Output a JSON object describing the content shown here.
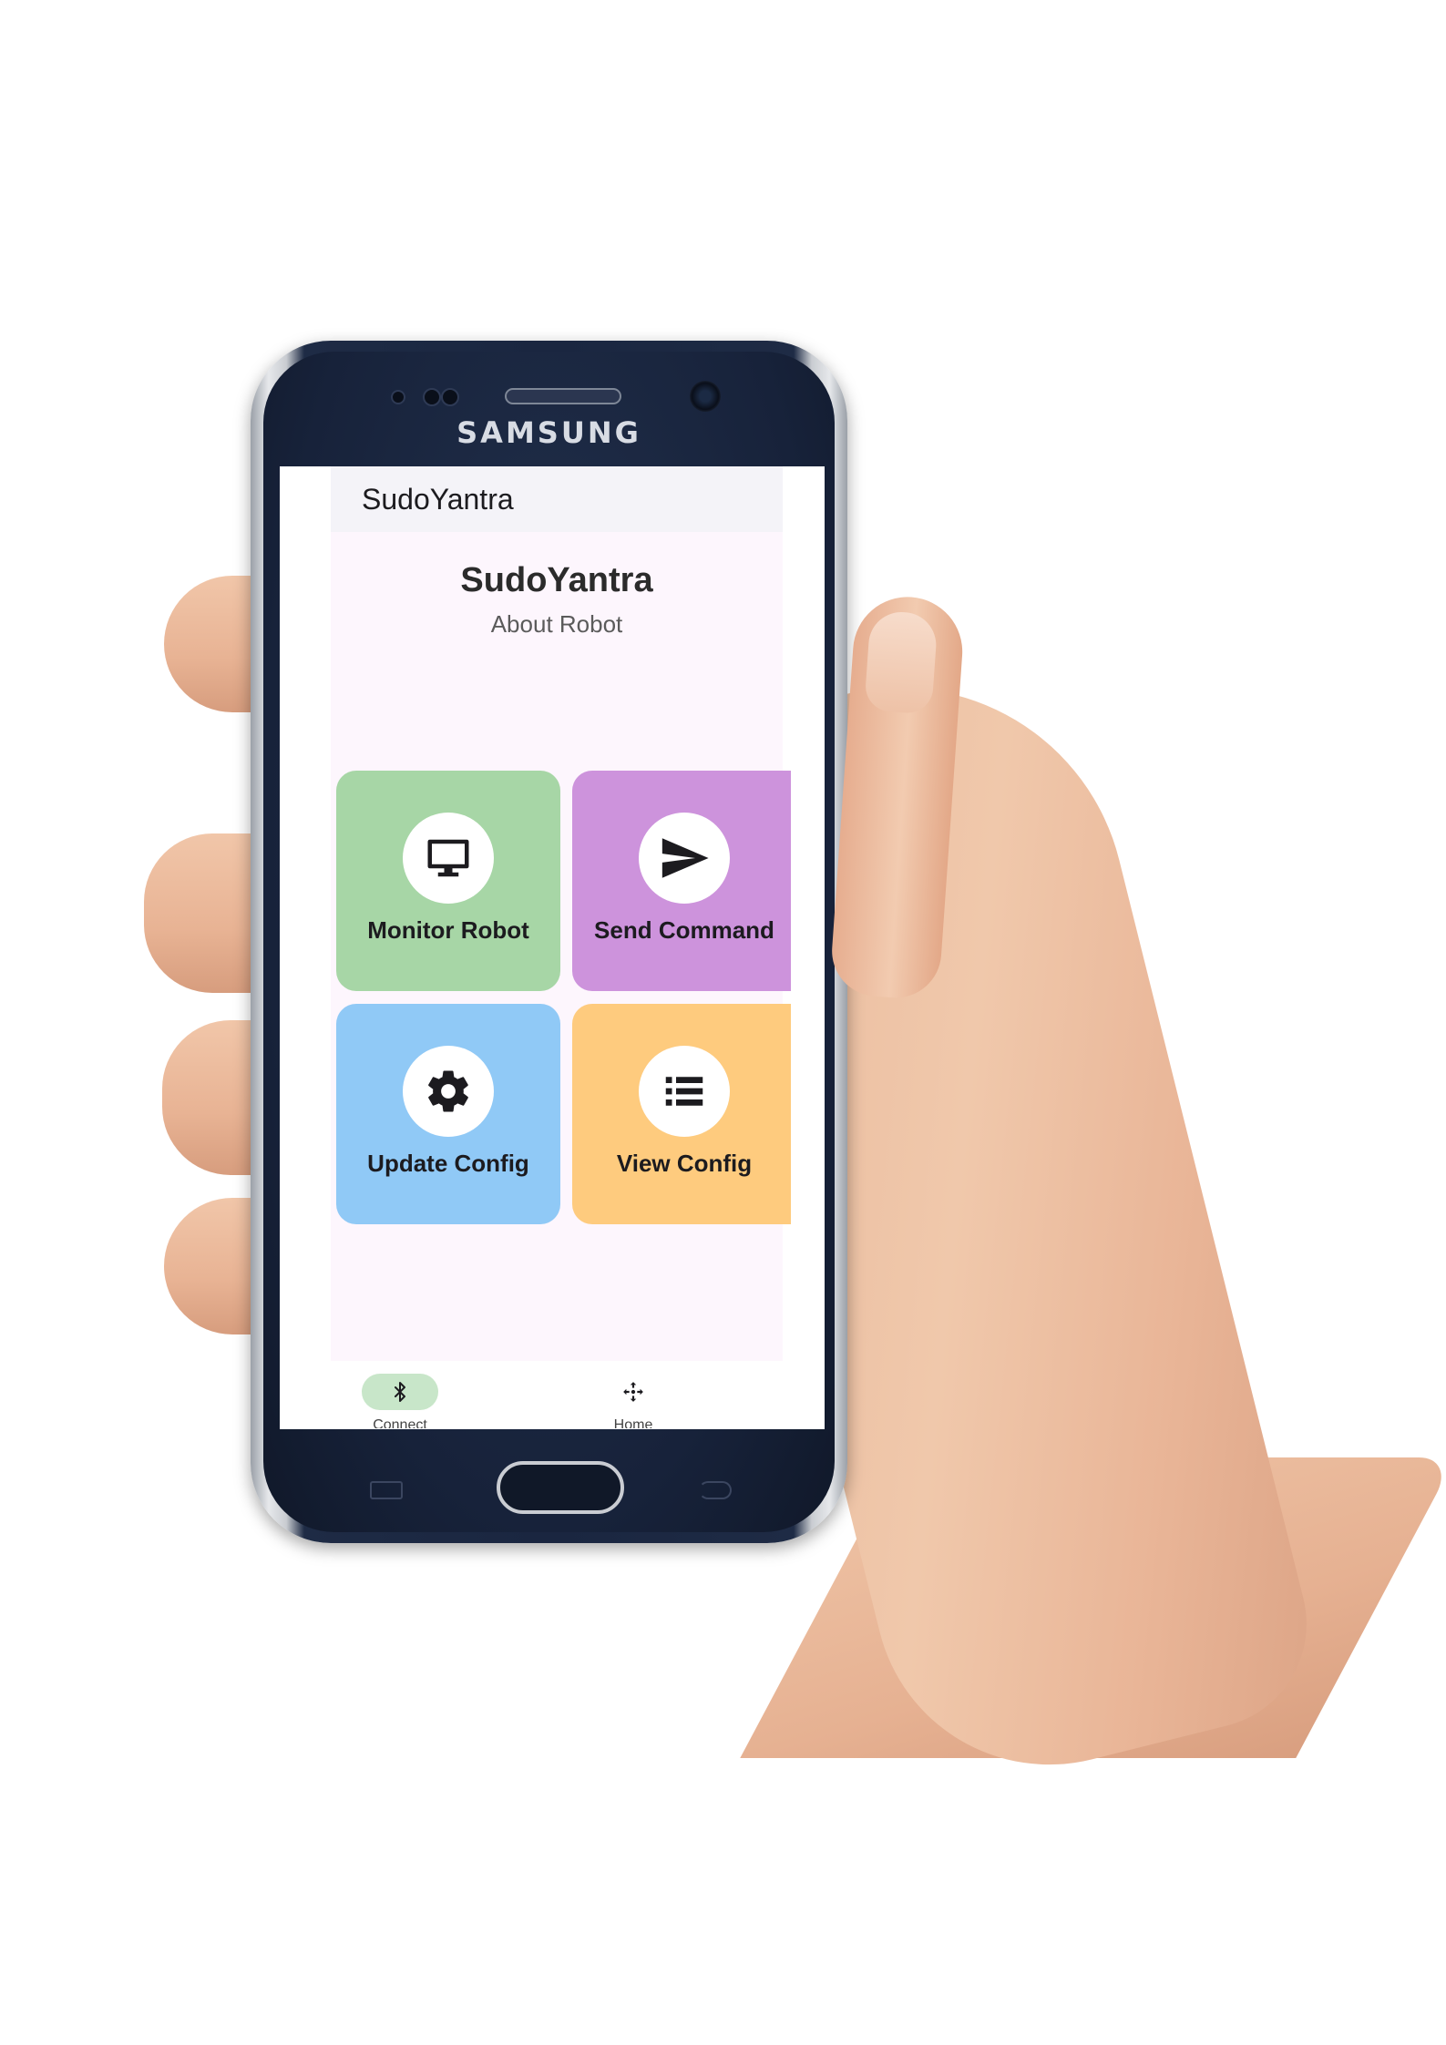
{
  "phone": {
    "brand": "SAMSUNG"
  },
  "app_bar": {
    "title": "SudoYantra"
  },
  "header": {
    "title": "SudoYantra",
    "subtitle": "About Robot"
  },
  "tiles": [
    {
      "label": "Monitor Robot",
      "icon": "monitor-icon",
      "color": "#a7d6a6"
    },
    {
      "label": "Send Command",
      "icon": "send-icon",
      "color": "#cd93dc"
    },
    {
      "label": "Update Config",
      "icon": "gear-icon",
      "color": "#90c9f6"
    },
    {
      "label": "View Config",
      "icon": "list-icon",
      "color": "#fecb7e"
    }
  ],
  "bottom_nav": {
    "items": [
      {
        "label": "Connect",
        "icon": "bluetooth-icon",
        "active": true,
        "active_color": "#c8e6c9"
      },
      {
        "label": "Home",
        "icon": "move-arrows-icon",
        "active": false
      }
    ]
  }
}
